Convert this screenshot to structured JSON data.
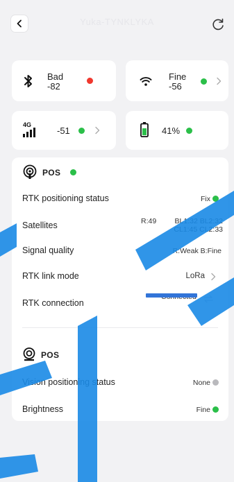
{
  "header": {
    "device_name": "Yuka-TYNKLYKA"
  },
  "status_cards": {
    "bluetooth": {
      "state": "Bad",
      "value": "-82",
      "dot_color": "#f0382e"
    },
    "wifi": {
      "state": "Fine",
      "value": "-56",
      "dot_color": "#2bbf49"
    },
    "cellular": {
      "badge": "4G",
      "value": "-51",
      "dot_color": "#2bbf49"
    },
    "battery": {
      "value": "41%",
      "dot_color": "#2bbf49",
      "level": 0.41
    }
  },
  "rtk_section": {
    "title": "POS",
    "status_dot_color": "#2bbf49",
    "rows": [
      {
        "label": "RTK positioning status",
        "value": "Fix",
        "dot": "green"
      },
      {
        "label": "Satellites",
        "value_main": "R:49",
        "value_line1": "BL1:32 BL2:32",
        "value_line2": "CL1:45 CL2:33"
      },
      {
        "label": "Signal quality",
        "value": "R:Weak B:Fine"
      },
      {
        "label": "RTK link mode",
        "value": "LoRa"
      },
      {
        "label": "RTK connection",
        "value": "Connected"
      }
    ]
  },
  "vision_section": {
    "title": "POS",
    "rows": [
      {
        "label": "Vision positioning status",
        "value": "None",
        "dot": "gray"
      },
      {
        "label": "Brightness",
        "value": "Fine",
        "dot": "green"
      }
    ]
  },
  "colors": {
    "accent_blue": "#3274d8",
    "status_green": "#2bbf49",
    "status_red": "#f0382e",
    "status_gray": "#b9b9bd"
  }
}
